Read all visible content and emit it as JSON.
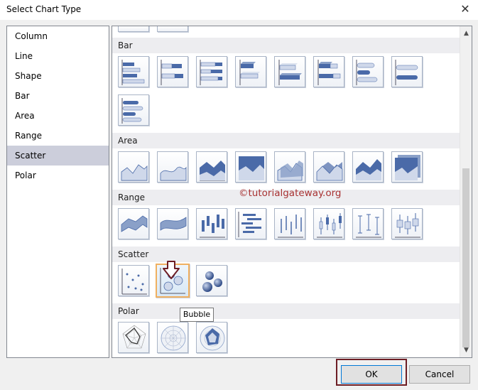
{
  "window": {
    "title": "Select Chart Type",
    "close_glyph": "✕"
  },
  "chart_types": [
    {
      "label": "Column",
      "selected": false
    },
    {
      "label": "Line",
      "selected": false
    },
    {
      "label": "Shape",
      "selected": false
    },
    {
      "label": "Bar",
      "selected": false
    },
    {
      "label": "Area",
      "selected": false
    },
    {
      "label": "Range",
      "selected": false
    },
    {
      "label": "Scatter",
      "selected": true
    },
    {
      "label": "Polar",
      "selected": false
    }
  ],
  "sections": {
    "bar": {
      "header": "Bar",
      "count": 10
    },
    "area": {
      "header": "Area",
      "count": 8
    },
    "range": {
      "header": "Range",
      "count": 8
    },
    "scatter": {
      "header": "Scatter",
      "count": 3,
      "selected_index": 1
    },
    "polar": {
      "header": "Polar",
      "count": 3
    }
  },
  "tooltip": "Bubble",
  "watermark": "©tutorialgateway.org",
  "buttons": {
    "ok": "OK",
    "cancel": "Cancel"
  },
  "colors": {
    "selection": "#cccedb",
    "section_header": "#ededf0",
    "thumb_highlight": "#f0b060",
    "annotation": "#6d1d24",
    "watermark": "#a83232",
    "chart_blue": "#4a6aa8"
  }
}
